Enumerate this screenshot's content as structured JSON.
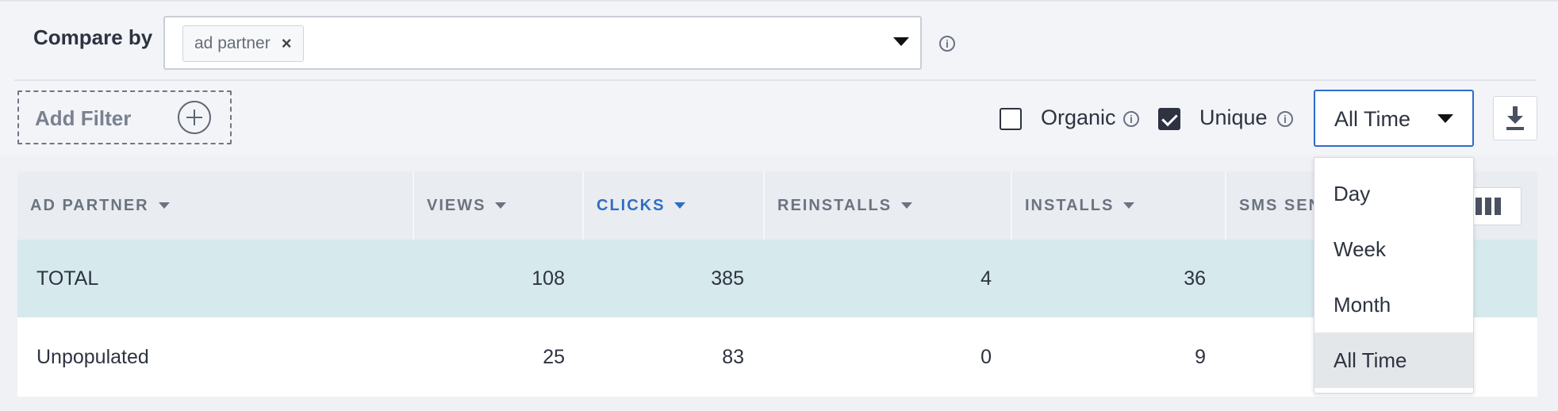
{
  "compare": {
    "label": "Compare by",
    "chip": "ad partner",
    "chip_remove": "×",
    "info": "i"
  },
  "filter": {
    "add_filter_label": "Add Filter",
    "organic_label": "Organic",
    "organic_checked": false,
    "unique_label": "Unique",
    "unique_checked": true,
    "info": "i",
    "time_value": "All Time"
  },
  "table": {
    "columns": [
      "AD PARTNER",
      "VIEWS",
      "CLICKS",
      "REINSTALLS",
      "INSTALLS",
      "SMS SEN"
    ],
    "active_column": "CLICKS",
    "rows": [
      {
        "name": "TOTAL",
        "views": "108",
        "clicks": "385",
        "reinstalls": "4",
        "installs": "36"
      },
      {
        "name": "Unpopulated",
        "views": "25",
        "clicks": "83",
        "reinstalls": "0",
        "installs": "9"
      }
    ]
  },
  "time_menu": {
    "options": [
      "Day",
      "Week",
      "Month",
      "All Time"
    ],
    "selected": "All Time"
  },
  "colors": {
    "accent": "#2d6cc8",
    "total_row": "#d6e9ec",
    "header": "#e9ecf1"
  }
}
